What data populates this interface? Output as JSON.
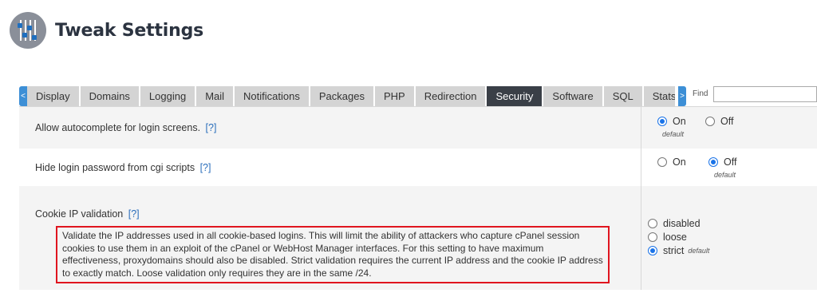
{
  "header": {
    "title": "Tweak Settings"
  },
  "tabs": [
    {
      "label": "Display",
      "active": false
    },
    {
      "label": "Domains",
      "active": false
    },
    {
      "label": "Logging",
      "active": false
    },
    {
      "label": "Mail",
      "active": false
    },
    {
      "label": "Notifications",
      "active": false
    },
    {
      "label": "Packages",
      "active": false
    },
    {
      "label": "PHP",
      "active": false
    },
    {
      "label": "Redirection",
      "active": false
    },
    {
      "label": "Security",
      "active": true
    },
    {
      "label": "Software",
      "active": false
    },
    {
      "label": "SQL",
      "active": false
    },
    {
      "label": "Stats",
      "active": false
    }
  ],
  "tabbar": {
    "scroll_left": "<",
    "scroll_right": ">",
    "find_label": "Find",
    "find_value": ""
  },
  "settings": [
    {
      "label": "Allow autocomplete for login screens.",
      "help": "[?]",
      "options": [
        {
          "label": "On",
          "checked": true
        },
        {
          "label": "Off",
          "checked": false
        }
      ],
      "default_note": "default"
    },
    {
      "label": "Hide login password from cgi scripts",
      "help": "[?]",
      "options": [
        {
          "label": "On",
          "checked": false
        },
        {
          "label": "Off",
          "checked": true
        }
      ],
      "default_note": "default"
    },
    {
      "label": "Cookie IP validation",
      "help": "[?]",
      "description": "Validate the IP addresses used in all cookie-based logins. This will limit the ability of attackers who capture cPanel session cookies to use them in an exploit of the cPanel or WebHost Manager interfaces. For this setting to have maximum effectiveness, proxydomains should also be disabled. Strict validation requires the current IP address and the cookie IP address to exactly match. Loose validation only requires they are in the same /24.",
      "options": [
        {
          "label": "disabled",
          "checked": false
        },
        {
          "label": "loose",
          "checked": false
        },
        {
          "label": "strict",
          "checked": true
        }
      ],
      "default_note": "default"
    }
  ],
  "colors": {
    "active_tab": "#3a3f47",
    "tab_bg": "#d4d4d4",
    "scroll_button": "#3d8fd6",
    "link": "#2a6ebb",
    "radio_checked": "#1a73e8",
    "highlight_border": "#e0151f"
  },
  "icons": {
    "logo": "sliders-icon"
  }
}
